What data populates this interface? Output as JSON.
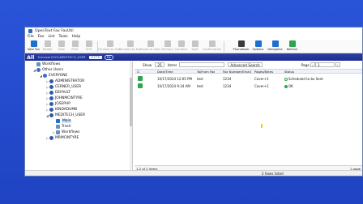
{
  "window": {
    "title": "OpenText Fax FaxUtil"
  },
  "menu": [
    "File",
    "Fax",
    "List",
    "Tools",
    "Help"
  ],
  "toolbar": {
    "buttons": [
      {
        "label": "New Fax",
        "icon": "new-fax-icon",
        "enabled": true
      },
      {
        "label": "Delete",
        "icon": "delete-icon",
        "enabled": false
      },
      {
        "label": "View",
        "icon": "view-icon",
        "enabled": false
      },
      {
        "label": "Print",
        "icon": "print-icon",
        "enabled": false
      },
      {
        "label": "OCR",
        "icon": "ocr-icon",
        "enabled": false
      },
      {
        "label": "Forward to User",
        "icon": "forward-to-user-icon",
        "enabled": false
      },
      {
        "label": "Forward to Fax",
        "icon": "forward-to-fax-icon",
        "enabled": false
      },
      {
        "label": "Route to User",
        "icon": "route-to-user-icon",
        "enabled": false
      },
      {
        "label": "Memory",
        "icon": "memory-icon",
        "enabled": false
      },
      {
        "label": "Combine",
        "icon": "combine-icon",
        "enabled": false
      },
      {
        "label": "Split",
        "icon": "split-icon",
        "enabled": false
      },
      {
        "label": "Confirmation",
        "icon": "confirmation-icon",
        "enabled": false
      }
    ],
    "right_buttons": [
      {
        "label": "Phonebook",
        "icon": "phonebook-icon"
      },
      {
        "label": "Options",
        "icon": "options-icon"
      },
      {
        "label": "Delegates",
        "icon": "delegates-icon"
      },
      {
        "label": "Refresh",
        "icon": "refresh-icon"
      }
    ]
  },
  "allbar": {
    "label": "All",
    "user": "Scheizer2022\\MEDITECH_USER",
    "count": "(7777)",
    "me": "Me"
  },
  "tree": {
    "items": [
      {
        "label": "Workflows",
        "icon": "folder-icon"
      },
      {
        "label": "Other Users",
        "icon": "group-icon"
      },
      {
        "label": "EVERYONE",
        "icon": "group-icon"
      },
      {
        "label": "ADMINISTRATOR",
        "icon": "user-icon"
      },
      {
        "label": "CERNER_USER",
        "icon": "user-icon"
      },
      {
        "label": "DEFAULT",
        "icon": "user-icon"
      },
      {
        "label": "JOHNMCINTYRE",
        "icon": "user-icon"
      },
      {
        "label": "JOSEPHP",
        "icon": "user-icon"
      },
      {
        "label": "KINDADUMB",
        "icon": "user-icon"
      },
      {
        "label": "MEDITECH_USER",
        "icon": "user-icon"
      },
      {
        "label": "Main",
        "icon": "mail-icon"
      },
      {
        "label": "Trash",
        "icon": "trash-icon"
      },
      {
        "label": "Workflows",
        "icon": "folder-icon"
      },
      {
        "label": "MRMCINTYRE",
        "icon": "user-icon"
      }
    ]
  },
  "main": {
    "show_label": "Show",
    "show_value": "25",
    "items_label": "items",
    "advanced_search": "Advanced Search",
    "page_label": "Page",
    "page_value": "1",
    "columns": [
      "Date/Time",
      "To/From Fax",
      "Fax Number/Email",
      "Pages/Bytes",
      "Status"
    ],
    "rows": [
      {
        "datetime": "10/17/2024 12:05 PM",
        "tofrom": "test",
        "number": "1234",
        "pages": "Cover+1",
        "status": "Scheduled to be Sent",
        "status_color": "#ffffff"
      },
      {
        "datetime": "10/17/2024 9:34 AM",
        "tofrom": "test",
        "number": "1234",
        "pages": "Cover+1",
        "status": "OK",
        "status_color": "#2da44e"
      }
    ],
    "footer_left": "1-2 of 2 items",
    "footer_right": "1 page"
  },
  "statusbar": {
    "text": "2 faxes listed"
  }
}
